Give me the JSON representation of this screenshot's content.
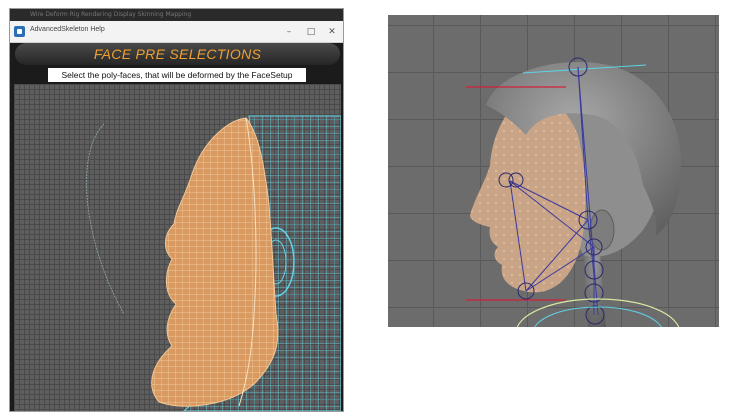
{
  "help_window": {
    "title": "AdvancedSkeleton Help",
    "top_strip": "Wire  Deform  Rig  Rendering  Display  Skinning  Mapping",
    "minimize_glyph": "–",
    "maximize_glyph": "□",
    "close_glyph": "✕",
    "banner_title": "FACE PRE SELECTIONS",
    "instruction": "Select the poly-faces, that will be deformed by the FaceSetup"
  },
  "colors": {
    "banner_text": "#f0a030",
    "selected_faces": "#e8a46a",
    "wireframe": "#5fd3e8",
    "joint_lines": "#3a3aa0",
    "red_guide": "#d0203a"
  },
  "icons": [
    "app-icon",
    "minimize-icon",
    "maximize-icon",
    "close-icon"
  ]
}
